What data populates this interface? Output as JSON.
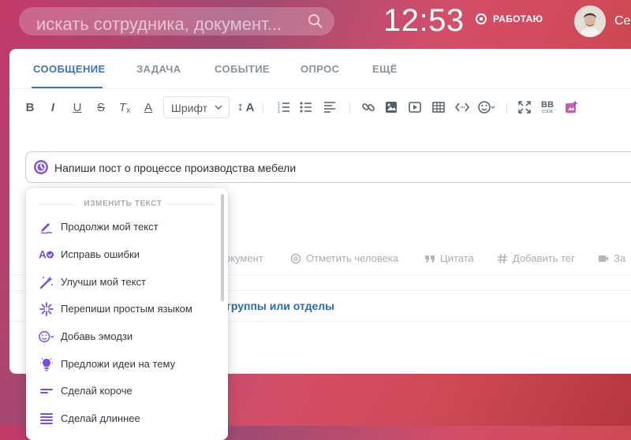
{
  "search": {
    "placeholder": "искать сотрудника, документ..."
  },
  "header": {
    "time": "12:53",
    "status": "РАБОТАЮ",
    "user_name": "Се"
  },
  "tabs": [
    {
      "label": "СООБЩЕНИЕ",
      "active": true
    },
    {
      "label": "ЗАДАЧА"
    },
    {
      "label": "СОБЫТИЕ"
    },
    {
      "label": "ОПРОС"
    },
    {
      "label": "ЕЩЁ"
    }
  ],
  "toolbar": {
    "bold": "B",
    "italic": "I",
    "underline": "U",
    "strike": "S",
    "clear_format": "T",
    "font_color": "A",
    "font_select": "Шрифт",
    "font_size_label": "A",
    "bbcode": "BB",
    "bbcode_sub": "CODE"
  },
  "ai_prompt": {
    "text": "Напиши пост о процессе производства мебели"
  },
  "attachments": [
    {
      "label": "окумент",
      "icon": "document-icon"
    },
    {
      "label": "Отметить человека",
      "icon": "at-icon"
    },
    {
      "label": "Цитата",
      "icon": "quote-icon"
    },
    {
      "label": "Добавить тег",
      "icon": "hash-icon"
    },
    {
      "label": "За",
      "icon": "video-icon"
    }
  ],
  "recipients": {
    "label": "группы или отделы"
  },
  "ai_menu": {
    "header": "ИЗМЕНИТЬ ТЕКСТ",
    "accent": "#7b4de0",
    "items": [
      {
        "label": "Продолжи мой текст",
        "icon": "pen-write-icon"
      },
      {
        "label": "Исправь ошибки",
        "icon": "spellcheck-icon"
      },
      {
        "label": "Улучши мой текст",
        "icon": "magic-wand-icon"
      },
      {
        "label": "Перепиши простым языком",
        "icon": "sparkle-icon"
      },
      {
        "label": "Добавь эмодзи",
        "icon": "emoji-icon"
      },
      {
        "label": "Предложи идеи на тему",
        "icon": "lightbulb-icon"
      },
      {
        "label": "Сделай короче",
        "icon": "shorten-icon"
      },
      {
        "label": "Сделай длиннее",
        "icon": "lengthen-icon"
      }
    ]
  }
}
